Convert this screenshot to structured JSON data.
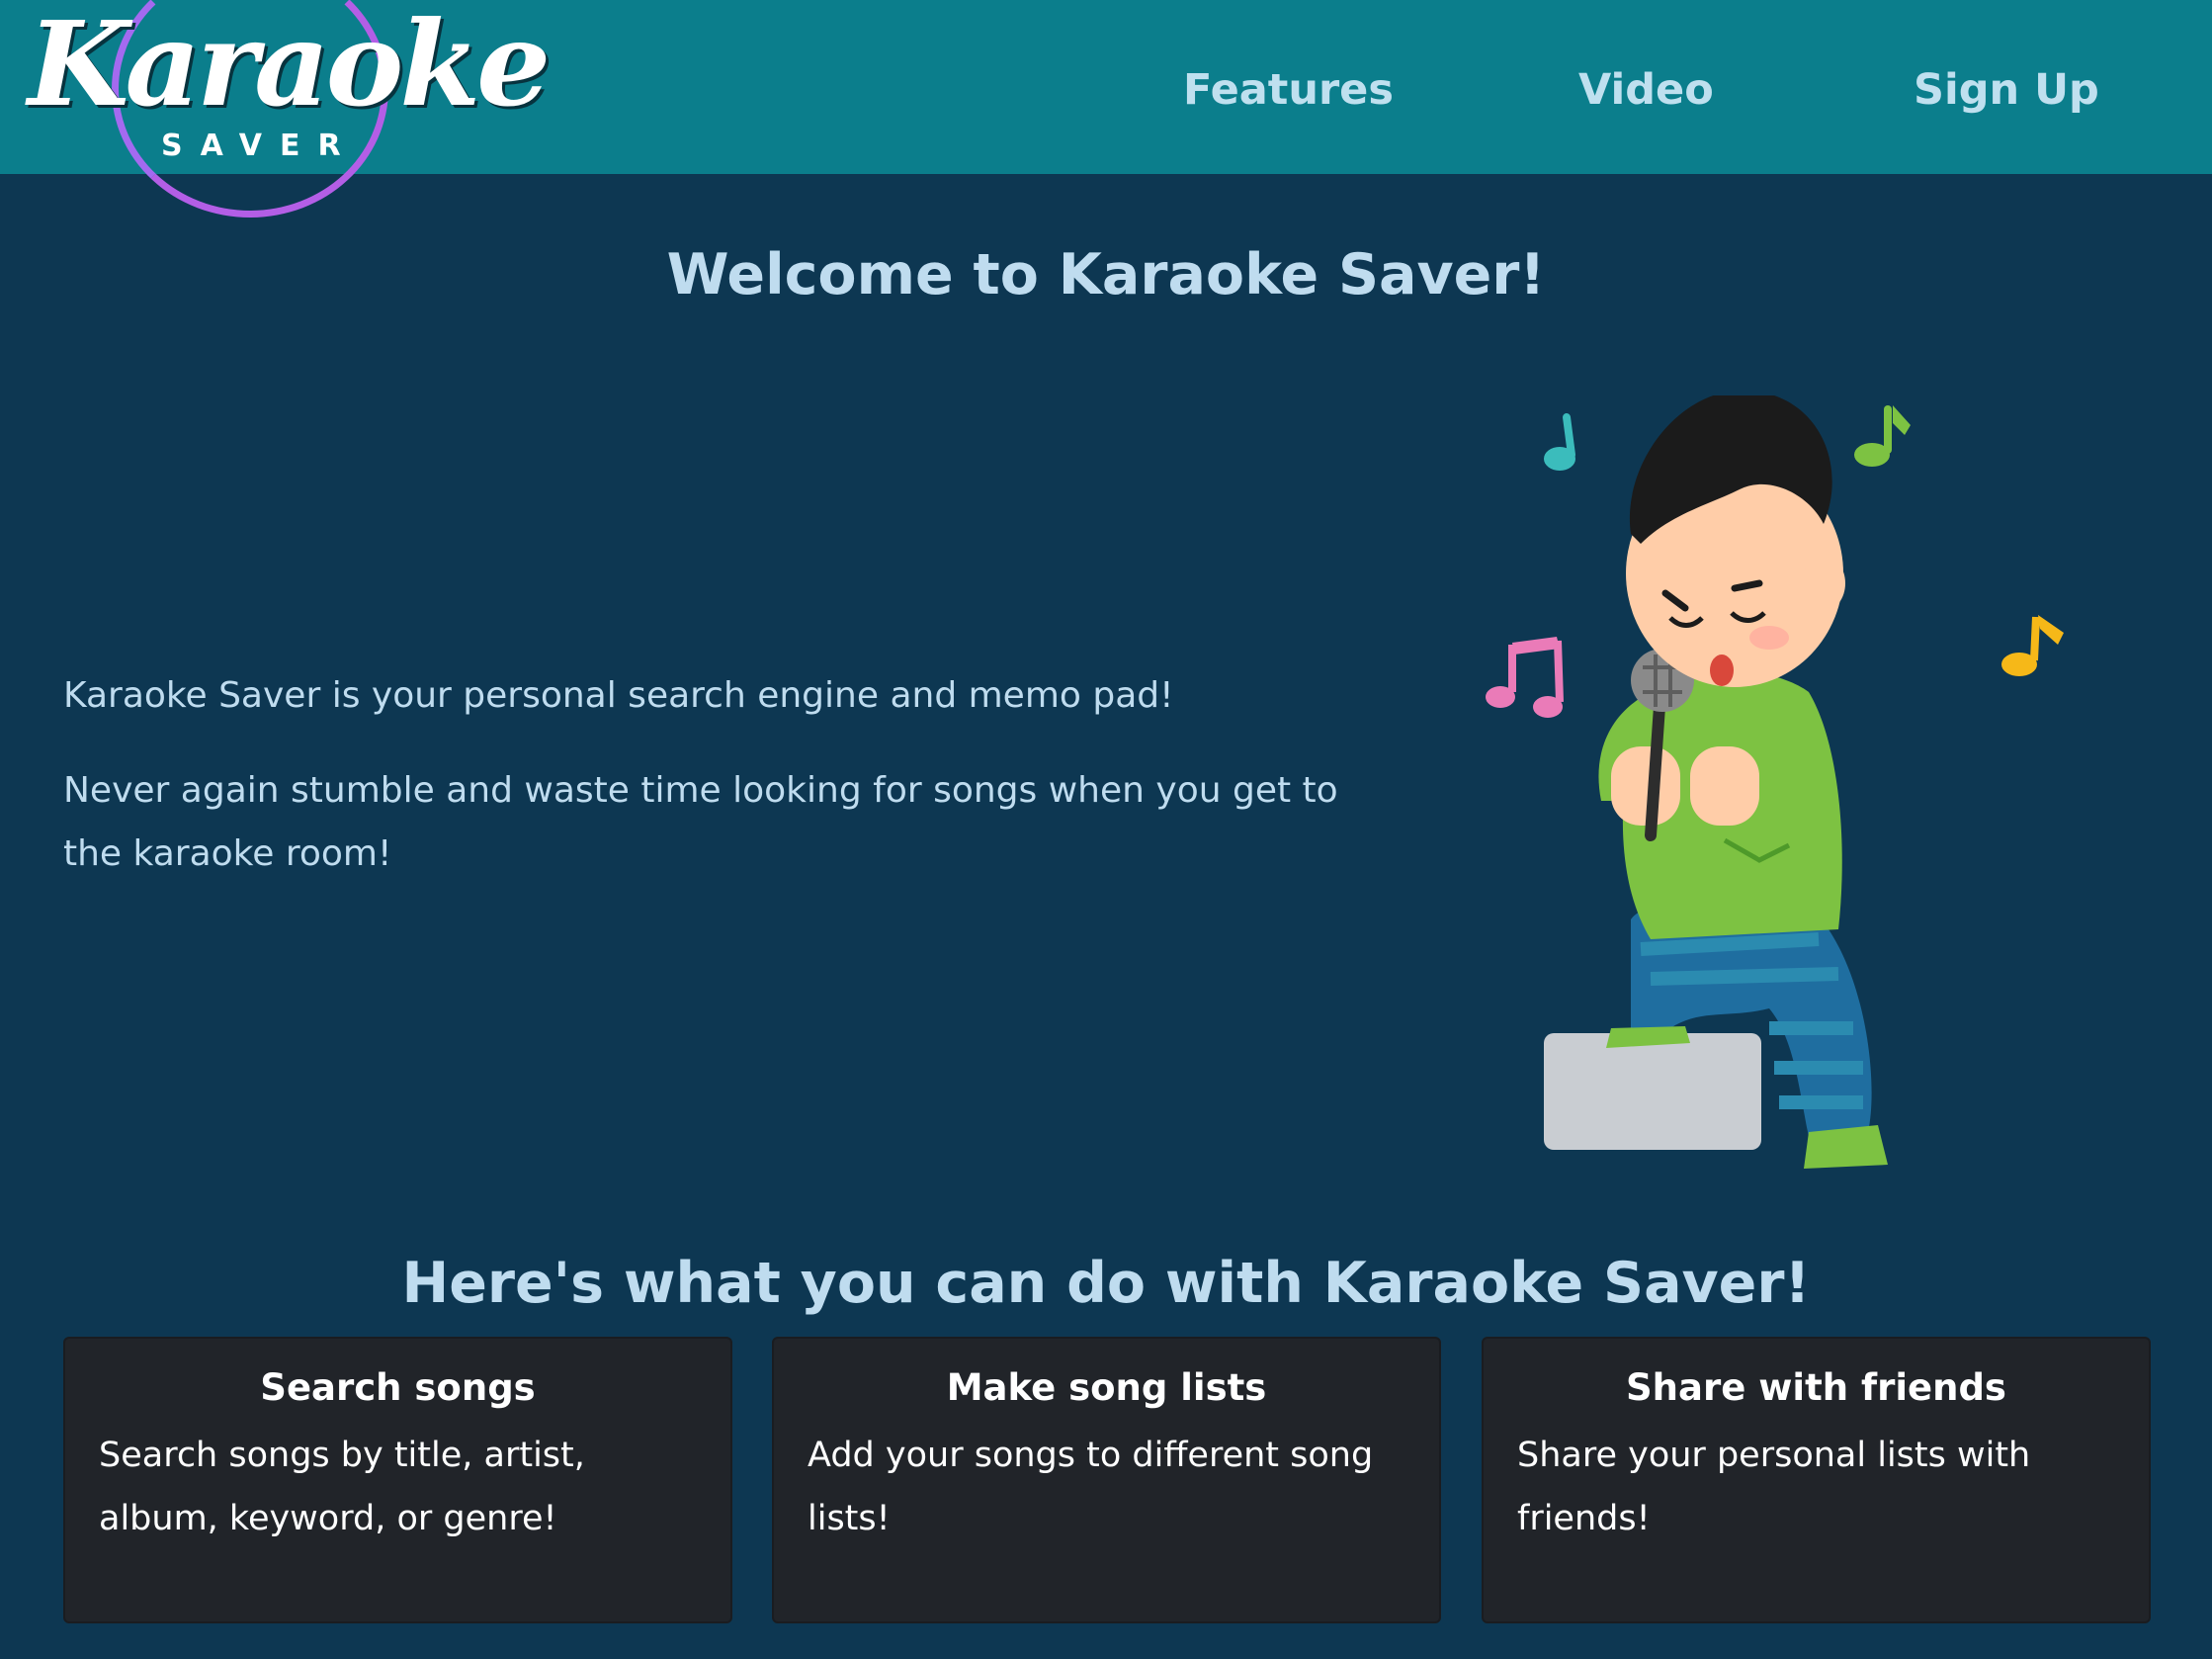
{
  "brand": {
    "logo_script": "Karaoke",
    "logo_sub": "SAVER",
    "colors": {
      "header": "#0b7e8c",
      "background": "#0d3752",
      "card": "#212429",
      "logo_ring": "#b35ee6",
      "text": "#bfdcef"
    }
  },
  "nav": {
    "links": [
      {
        "label": "Features"
      },
      {
        "label": "Video"
      },
      {
        "label": "Sign Up"
      }
    ]
  },
  "hero": {
    "title": "Welcome to Karaoke Saver!",
    "paragraphs": [
      "Karaoke Saver is your personal search engine and memo pad!",
      "Never again stumble and waste time looking for songs when you get to the karaoke room!"
    ],
    "illustration_icon": "karaoke-singer-illustration"
  },
  "features": {
    "title": "Here's what you can do with Karaoke Saver!",
    "cards": [
      {
        "title": "Search songs",
        "text": "Search songs by title, artist, album, keyword, or genre!"
      },
      {
        "title": "Make song lists",
        "text": "Add your songs to different song lists!"
      },
      {
        "title": "Share with friends",
        "text": "Share your personal lists with friends!"
      }
    ]
  }
}
